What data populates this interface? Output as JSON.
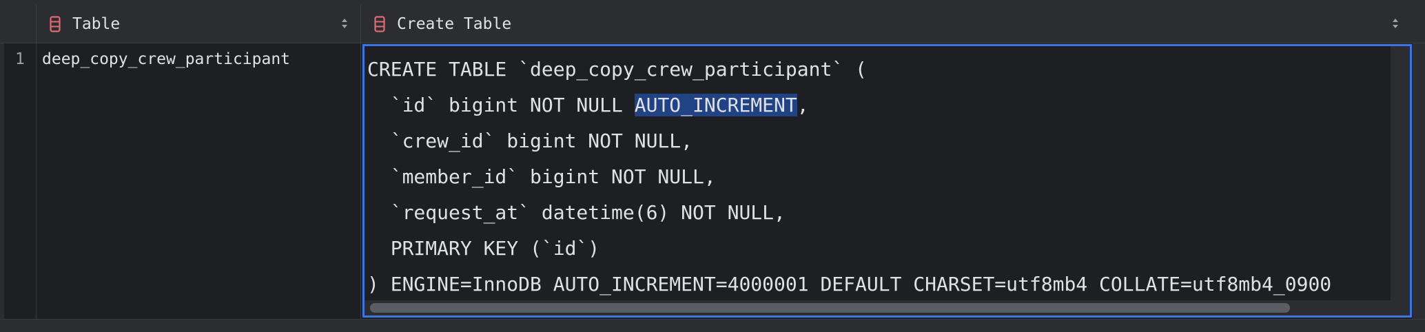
{
  "header": {
    "columns": [
      {
        "label": "Table",
        "icon": "column-icon"
      },
      {
        "label": "Create Table",
        "icon": "column-icon"
      }
    ]
  },
  "rows": [
    {
      "num": "1",
      "table": "deep_copy_crew_participant"
    }
  ],
  "editor": {
    "lines": [
      "CREATE TABLE `deep_copy_crew_participant` (",
      "  `id` bigint NOT NULL ",
      "AUTO_INCREMENT",
      ",",
      "  `crew_id` bigint NOT NULL,",
      "  `member_id` bigint NOT NULL,",
      "  `request_at` datetime(6) NOT NULL,",
      "  PRIMARY KEY (`id`)",
      ") ENGINE=InnoDB AUTO_INCREMENT=4000001 DEFAULT CHARSET=utf8mb4 COLLATE=utf8mb4_0900"
    ],
    "selection_color": "#214283",
    "focus_border_color": "#3d74e6"
  },
  "colors": {
    "icon_red": "#e06c75",
    "background": "#1e1f22",
    "header_bg": "#2b2d30"
  }
}
